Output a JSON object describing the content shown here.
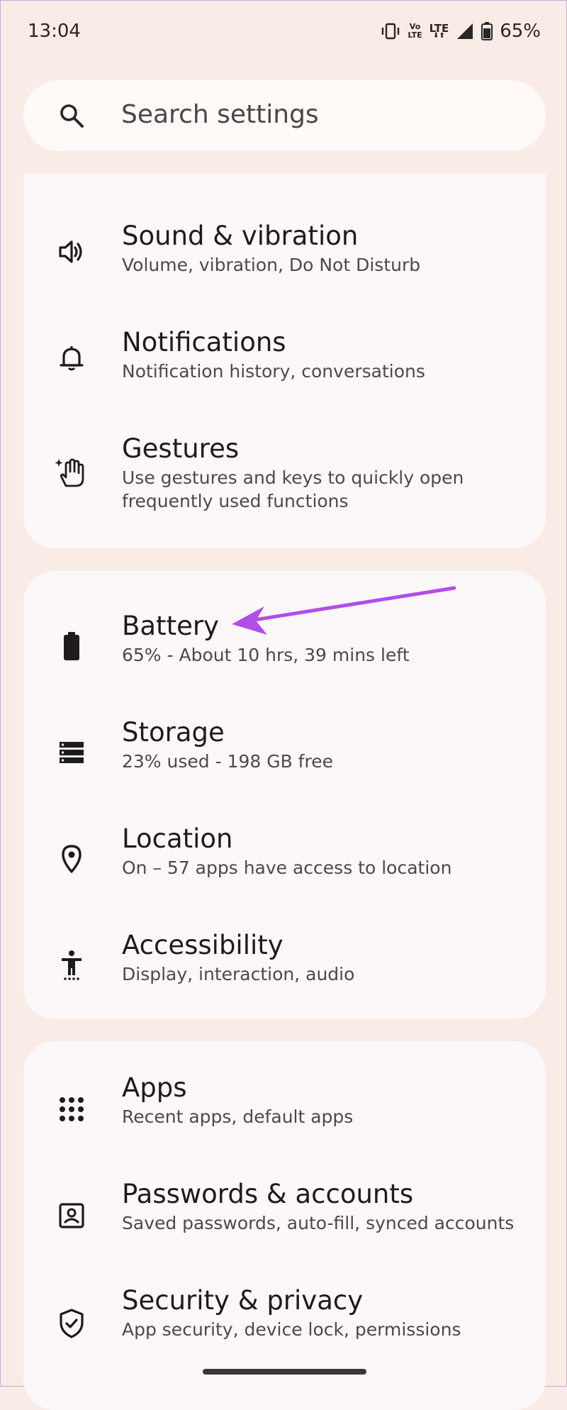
{
  "status_bar": {
    "time": "13:04",
    "volte_top": "Vo",
    "volte_bottom": "LTE",
    "lte": "LTE",
    "battery": "65%"
  },
  "search": {
    "placeholder": "Search settings",
    "icon": "search-icon"
  },
  "groups": [
    {
      "items": [
        {
          "icon": "volume-icon",
          "title": "Sound & vibration",
          "subtitle": "Volume, vibration, Do Not Disturb"
        },
        {
          "icon": "bell-icon",
          "title": "Notifications",
          "subtitle": "Notification history, conversations"
        },
        {
          "icon": "gesture-hand-icon",
          "title": "Gestures",
          "subtitle": "Use gestures and keys to quickly open frequently used functions"
        }
      ]
    },
    {
      "items": [
        {
          "icon": "battery-icon",
          "title": "Battery",
          "subtitle": "65% - About 10 hrs, 39 mins left"
        },
        {
          "icon": "storage-icon",
          "title": "Storage",
          "subtitle": "23% used - 198 GB free"
        },
        {
          "icon": "location-pin-icon",
          "title": "Location",
          "subtitle": "On – 57 apps have access to location"
        },
        {
          "icon": "accessibility-icon",
          "title": "Accessibility",
          "subtitle": "Display, interaction, audio"
        }
      ]
    },
    {
      "items": [
        {
          "icon": "apps-grid-icon",
          "title": "Apps",
          "subtitle": "Recent apps, default apps"
        },
        {
          "icon": "account-box-icon",
          "title": "Passwords & accounts",
          "subtitle": "Saved passwords, auto-fill, synced accounts"
        },
        {
          "icon": "shield-check-icon",
          "title": "Security & privacy",
          "subtitle": "App security, device lock, permissions"
        }
      ]
    }
  ],
  "colors": {
    "background": "#f9ebe6",
    "card": "#fcf7f8",
    "annotation_arrow": "#b04ee8"
  }
}
